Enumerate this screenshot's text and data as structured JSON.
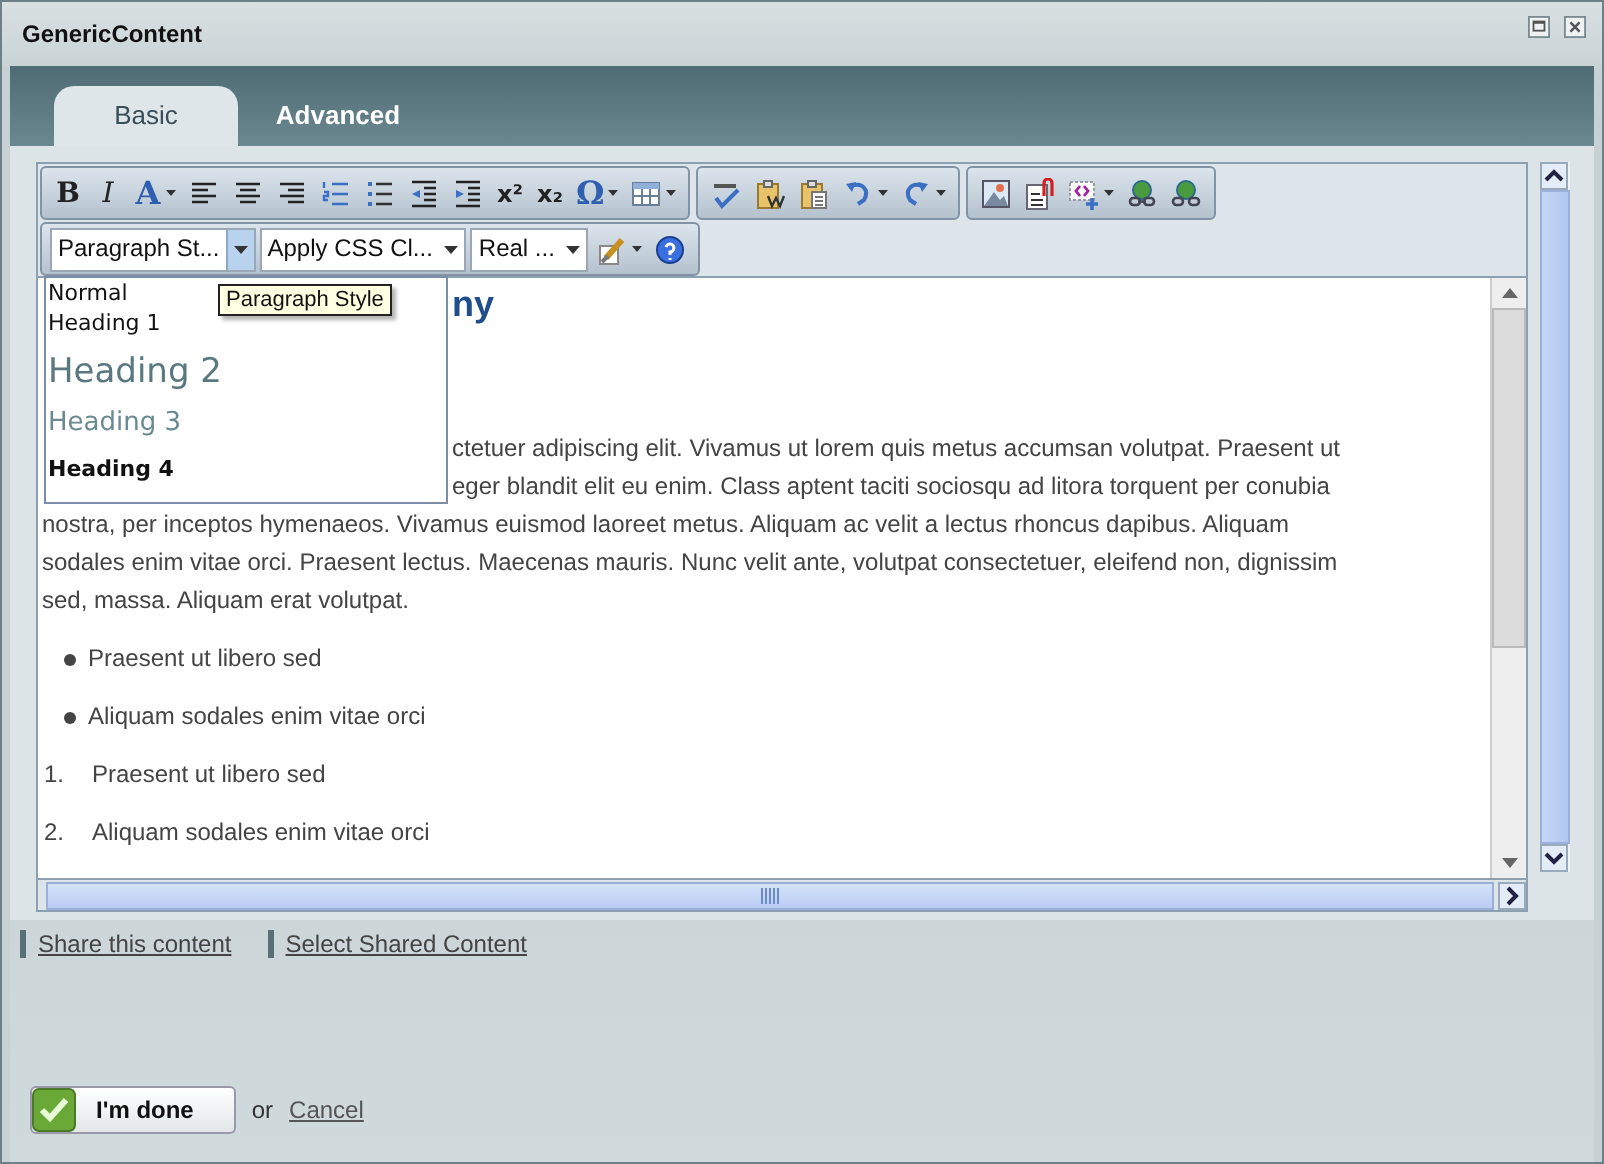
{
  "window": {
    "title": "GenericContent"
  },
  "tabs": [
    {
      "label": "Basic",
      "selected": true
    },
    {
      "label": "Advanced",
      "selected": false
    }
  ],
  "toolbar": {
    "rows": [
      {
        "groups": [
          [
            {
              "kind": "glyph",
              "glyph": "B",
              "menu": false
            },
            {
              "kind": "glyph",
              "glyph": "I",
              "menu": false
            },
            {
              "kind": "glyph",
              "glyph": "A",
              "menu": true
            },
            {
              "kind": "icon",
              "menu": false
            },
            {
              "kind": "icon",
              "menu": false
            },
            {
              "kind": "icon",
              "menu": false
            },
            {
              "kind": "icon",
              "menu": false
            },
            {
              "kind": "icon",
              "menu": false
            },
            {
              "kind": "icon",
              "menu": false
            },
            {
              "kind": "icon",
              "menu": false
            },
            {
              "kind": "glyph",
              "glyph": "x²",
              "menu": false
            },
            {
              "kind": "glyph",
              "glyph": "x₂",
              "menu": false
            },
            {
              "kind": "glyph",
              "glyph": "Ω",
              "menu": true
            },
            {
              "kind": "icon",
              "menu": true
            }
          ],
          [
            {
              "kind": "icon",
              "menu": false
            },
            {
              "kind": "icon",
              "menu": false
            },
            {
              "kind": "icon",
              "menu": false
            },
            {
              "kind": "icon",
              "menu": true
            },
            {
              "kind": "icon",
              "menu": true
            }
          ],
          [
            {
              "kind": "icon",
              "menu": false
            },
            {
              "kind": "icon",
              "menu": false
            },
            {
              "kind": "icon",
              "menu": true
            },
            {
              "kind": "icon",
              "menu": false
            },
            {
              "kind": "icon",
              "menu": false
            }
          ]
        ]
      },
      {
        "groups": [
          [
            {
              "kind": "select",
              "text": "Paragraph St...",
              "open": true
            },
            {
              "kind": "select",
              "text": "Apply CSS Cl...",
              "open": false
            },
            {
              "kind": "select",
              "text": "Real ...",
              "open": false
            },
            {
              "kind": "icon",
              "menu": true
            },
            {
              "kind": "icon",
              "menu": false
            }
          ]
        ]
      }
    ]
  },
  "style_menu": {
    "items": [
      {
        "kind": "normal",
        "label": "Normal"
      },
      {
        "kind": "h1",
        "label": "Heading 1"
      },
      {
        "kind": "h2",
        "label": "Heading 2"
      },
      {
        "kind": "h3",
        "label": "Heading 3"
      },
      {
        "kind": "h4",
        "label": "Heading 4"
      }
    ],
    "tooltip": "Paragraph Style"
  },
  "document": {
    "heading": "ny",
    "lines": [
      {
        "kind": "partial",
        "text": "ctetuer adipiscing elit. Vivamus ut lorem quis metus accumsan volutpat. Praesent ut"
      },
      {
        "kind": "partial",
        "text": "eger blandit elit eu enim. Class aptent taciti sociosqu ad litora torquent per conubia"
      },
      {
        "kind": "full",
        "text": "nostra, per inceptos hymenaeos. Vivamus euismod laoreet metus. Aliquam ac velit a lectus rhoncus dapibus. Aliquam"
      },
      {
        "kind": "full",
        "text": "sodales enim vitae orci. Praesent lectus. Maecenas mauris. Nunc velit ante, volutpat consectetuer, eleifend non, dignissim"
      },
      {
        "kind": "full",
        "text": "sed, massa. Aliquam erat volutpat."
      }
    ],
    "lists": [
      {
        "kind": "bullet",
        "items": [
          {
            "text": "Praesent ut libero sed"
          },
          {
            "text": "Aliquam sodales enim vitae orci"
          }
        ]
      },
      {
        "kind": "number",
        "items": [
          {
            "marker": "1.",
            "text": "Praesent ut libero sed"
          },
          {
            "marker": "2.",
            "text": "Aliquam sodales enim vitae orci"
          }
        ]
      }
    ]
  },
  "links": [
    "Share this content",
    "Select Shared Content"
  ],
  "footer": {
    "done": "I'm done",
    "or": "or",
    "cancel": "Cancel"
  }
}
